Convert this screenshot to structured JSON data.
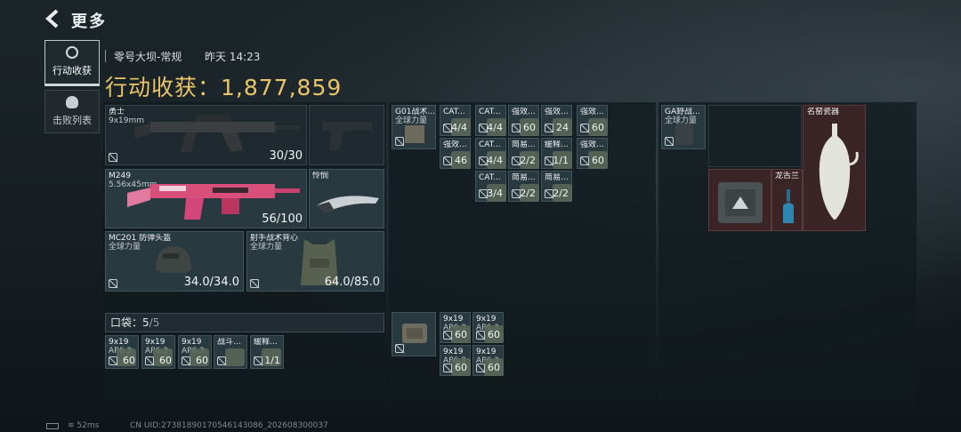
{
  "topbar": {
    "back_icon": "chevron-left-icon",
    "title": "更多"
  },
  "tabs": [
    {
      "label": "行动收获",
      "icon": "loot-icon",
      "active": true
    },
    {
      "label": "击败列表",
      "icon": "skull-icon",
      "active": false
    }
  ],
  "match": {
    "map": "零号大坝-常规",
    "time": "昨天 14:23"
  },
  "haul": {
    "label": "行动收获：",
    "value": "1,877,859",
    "color": "#e9c46a"
  },
  "equipment": {
    "primary": {
      "name": "勇士",
      "sub": "9x19mm",
      "count": "30/30"
    },
    "secondary": {
      "name": "M249",
      "sub": "5.56x45mm",
      "count": "56/100"
    },
    "pistol": {
      "name": ""
    },
    "melee": {
      "name": "怜悯"
    },
    "helmet": {
      "name": "MC201 防弹头盔",
      "sub": "全球力量",
      "count": "34.0/34.0"
    },
    "armor": {
      "name": "射手战术背心",
      "sub": "全球力量",
      "count": "64.0/85.0"
    }
  },
  "pouch": {
    "label": "口袋：",
    "value": "5",
    "max": "/5",
    "items": [
      {
        "name": "9x19",
        "sub": "AP6.3",
        "count": "60"
      },
      {
        "name": "9x19",
        "sub": "AP6.3",
        "count": "60"
      },
      {
        "name": "9x19",
        "sub": "AP6.3",
        "count": "60"
      },
      {
        "name": "战斗...",
        "sub": "",
        "count": ""
      },
      {
        "name": "缓释...",
        "sub": "",
        "count": "1/1"
      }
    ]
  },
  "chest_rig": {
    "name": "G01战术...",
    "sub": "全球力量",
    "items": [
      {
        "name": "CAT...",
        "count": "4/4"
      },
      {
        "name": "CAT...",
        "count": "4/4"
      },
      {
        "name": "强效...",
        "count": "60"
      },
      {
        "name": "强效...",
        "count": "24"
      },
      {
        "name": "强效...",
        "count": "60"
      },
      {
        "name": "强效...",
        "count": "46"
      },
      {
        "name": "CAT...",
        "count": "4/4"
      },
      {
        "name": "简易...",
        "count": "2/2"
      },
      {
        "name": "缓释...",
        "count": "1/1"
      },
      {
        "name": "强效...",
        "count": "60"
      },
      {
        "name": "CAT...",
        "count": "3/4"
      },
      {
        "name": "简易...",
        "count": "2/2"
      },
      {
        "name": "简易...",
        "count": "2/2"
      }
    ]
  },
  "bag_items": [
    {
      "name": "9x19",
      "sub": "AP6.3",
      "count": "60"
    },
    {
      "name": "9x19",
      "sub": "AP6.3",
      "count": "60"
    },
    {
      "name": "9x19",
      "sub": "AP6.3",
      "count": "60"
    },
    {
      "name": "9x19",
      "sub": "AP6.3",
      "count": "60"
    }
  ],
  "backpack": {
    "name": "GA野战...",
    "sub": "全球力量",
    "items": [
      {
        "name": "名窑瓷器"
      },
      {
        "name": "龙舌兰"
      },
      {
        "name": ""
      }
    ]
  },
  "footer": {
    "ping": "52ms",
    "uid": "CN UID:27381890170546143086_202608300037"
  }
}
